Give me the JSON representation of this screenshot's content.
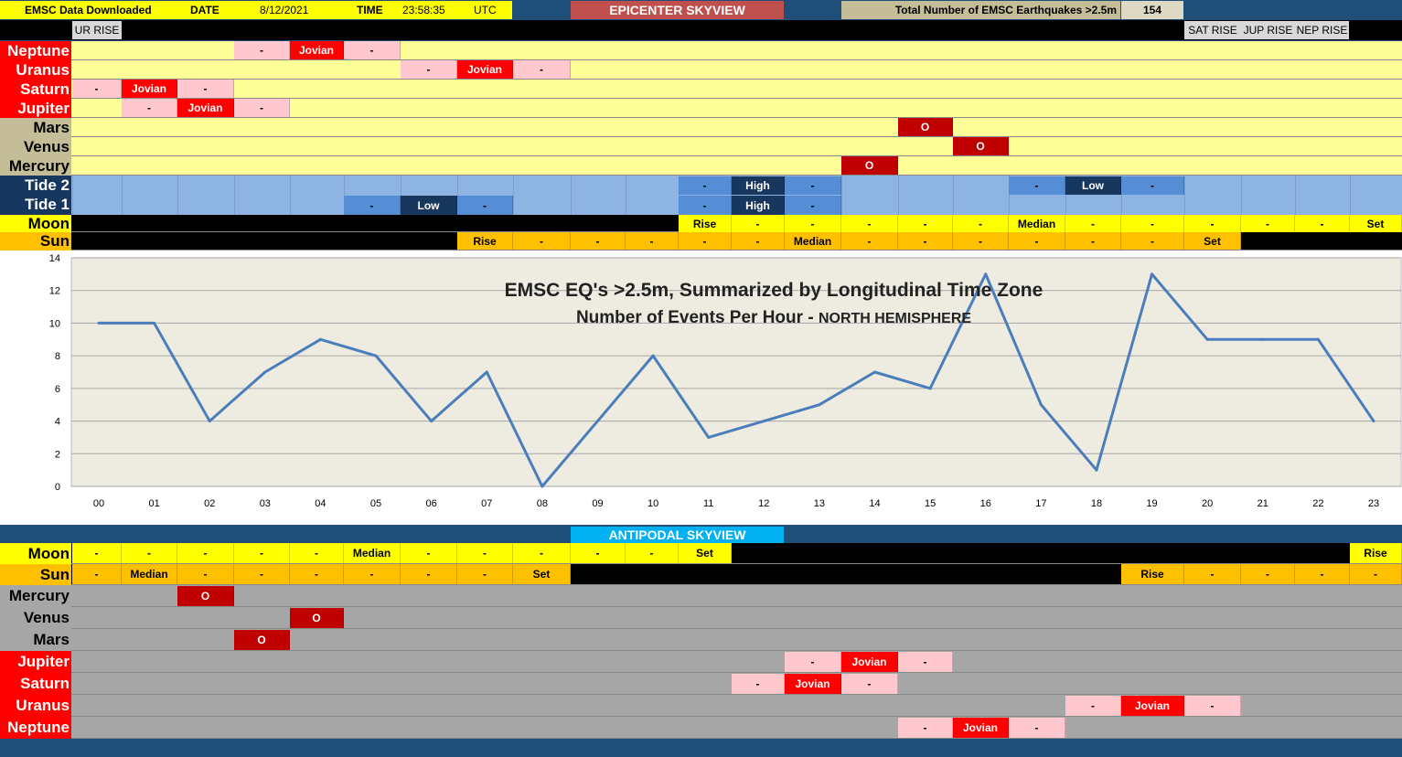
{
  "header": {
    "downloaded_label": "EMSC Data Downloaded",
    "date_label": "DATE",
    "date": "8/12/2021",
    "time_label": "TIME",
    "time": "23:58:35",
    "tz": "UTC",
    "title": "EPICENTER SKYVIEW",
    "total_label": "Total Number of EMSC Earthquakes >2.5m",
    "total": "154"
  },
  "rise_labels": {
    "ur": "UR RISE",
    "sat": "SAT RISE",
    "jup": "JUP RISE",
    "nep": "NEP RISE"
  },
  "epicenter_rows": [
    {
      "label": "Neptune",
      "cells": [
        [
          "-",
          3,
          "pink"
        ],
        [
          "Jovian",
          4,
          "red"
        ],
        [
          "-",
          5,
          "pink"
        ]
      ]
    },
    {
      "label": "Uranus",
      "cells": [
        [
          "-",
          6,
          "pink"
        ],
        [
          "Jovian",
          7,
          "red"
        ],
        [
          "-",
          8,
          "pink"
        ]
      ]
    },
    {
      "label": "Saturn",
      "cells": [
        [
          "-",
          0,
          "pink"
        ],
        [
          "Jovian",
          1,
          "red"
        ],
        [
          "-",
          2,
          "pink"
        ]
      ]
    },
    {
      "label": "Jupiter",
      "cells": [
        [
          "-",
          1,
          "pink"
        ],
        [
          "Jovian",
          2,
          "red"
        ],
        [
          "-",
          3,
          "pink"
        ]
      ]
    },
    {
      "label": "Mars",
      "cells": [
        [
          "O",
          15,
          "dred"
        ]
      ]
    },
    {
      "label": "Venus",
      "cells": [
        [
          "O",
          16,
          "dred"
        ]
      ]
    },
    {
      "label": "Mercury",
      "cells": [
        [
          "O",
          14,
          "dred"
        ]
      ]
    }
  ],
  "tides": {
    "tide2_label": "Tide 2",
    "tide1_label": "Tide 1",
    "tide2_cells": [
      [
        "-",
        11
      ],
      [
        "High",
        12
      ],
      [
        "-",
        13
      ],
      [
        "-",
        17
      ],
      [
        "Low",
        18
      ],
      [
        "-",
        19
      ]
    ],
    "tide1_cells": [
      [
        "-",
        5
      ],
      [
        "Low",
        6
      ],
      [
        "-",
        7
      ],
      [
        "-",
        11
      ],
      [
        "High",
        12
      ],
      [
        "-",
        13
      ]
    ]
  },
  "epi_moon": {
    "label": "Moon",
    "cells": [
      [
        "Rise",
        11
      ],
      [
        "-",
        12
      ],
      [
        "-",
        13
      ],
      [
        "-",
        14
      ],
      [
        "-",
        15
      ],
      [
        "-",
        16
      ],
      [
        "Median",
        17
      ],
      [
        "-",
        18
      ],
      [
        "-",
        19
      ],
      [
        "-",
        20
      ],
      [
        "-",
        21
      ],
      [
        "-",
        22
      ],
      [
        "Set",
        23
      ]
    ]
  },
  "epi_sun": {
    "label": "Sun",
    "cells": [
      [
        "Rise",
        7
      ],
      [
        "-",
        8
      ],
      [
        "-",
        9
      ],
      [
        "-",
        10
      ],
      [
        "-",
        11
      ],
      [
        "-",
        12
      ],
      [
        "Median",
        13
      ],
      [
        "-",
        14
      ],
      [
        "-",
        15
      ],
      [
        "-",
        16
      ],
      [
        "-",
        17
      ],
      [
        "-",
        18
      ],
      [
        "-",
        19
      ],
      [
        "Set",
        20
      ]
    ]
  },
  "chart_data": {
    "type": "line",
    "title": "EMSC EQ's >2.5m, Summarized by Longitudinal Time Zone",
    "subtitle_main": "Number of Events Per Hour - ",
    "subtitle_tail": "NORTH  HEMISPHERE",
    "categories": [
      "00",
      "01",
      "02",
      "03",
      "04",
      "05",
      "06",
      "07",
      "08",
      "09",
      "10",
      "11",
      "12",
      "13",
      "14",
      "15",
      "16",
      "17",
      "18",
      "19",
      "20",
      "21",
      "22",
      "23"
    ],
    "values": [
      10,
      10,
      4,
      7,
      9,
      8,
      4,
      7,
      0,
      4,
      8,
      3,
      4,
      5,
      7,
      6,
      13,
      5,
      1,
      13,
      9,
      9,
      9,
      4
    ],
    "yticks": [
      "0",
      "2",
      "4",
      "6",
      "8",
      "10",
      "12",
      "14"
    ],
    "ylim": [
      0,
      14
    ],
    "grid": true,
    "line_color": "#4a7ebb"
  },
  "antipodal": {
    "title": "ANTIPODAL SKYVIEW",
    "moon": {
      "label": "Moon",
      "cells": [
        [
          "-",
          0
        ],
        [
          "-",
          1
        ],
        [
          "-",
          2
        ],
        [
          "-",
          3
        ],
        [
          "-",
          4
        ],
        [
          "Median",
          5
        ],
        [
          "-",
          6
        ],
        [
          "-",
          7
        ],
        [
          "-",
          8
        ],
        [
          "-",
          9
        ],
        [
          "-",
          10
        ],
        [
          "Set",
          11
        ],
        [
          "Rise",
          23
        ]
      ]
    },
    "sun": {
      "label": "Sun",
      "cells": [
        [
          "-",
          0
        ],
        [
          "Median",
          1
        ],
        [
          "-",
          2
        ],
        [
          "-",
          3
        ],
        [
          "-",
          4
        ],
        [
          "-",
          5
        ],
        [
          "-",
          6
        ],
        [
          "-",
          7
        ],
        [
          "Set",
          8
        ],
        [
          "Rise",
          19
        ],
        [
          "-",
          20
        ],
        [
          "-",
          21
        ],
        [
          "-",
          22
        ],
        [
          "-",
          23
        ]
      ]
    },
    "rows": [
      {
        "label": "Mercury",
        "cells": [
          [
            "O",
            2,
            "dred"
          ]
        ]
      },
      {
        "label": "Venus",
        "cells": [
          [
            "O",
            4,
            "dred"
          ]
        ]
      },
      {
        "label": "Mars",
        "cells": [
          [
            "O",
            3,
            "dred"
          ]
        ]
      },
      {
        "label": "Jupiter",
        "cells": [
          [
            "-",
            13,
            "pink"
          ],
          [
            "Jovian",
            14,
            "red"
          ],
          [
            "-",
            15,
            "pink"
          ]
        ]
      },
      {
        "label": "Saturn",
        "cells": [
          [
            "-",
            12,
            "pink"
          ],
          [
            "Jovian",
            13,
            "red"
          ],
          [
            "-",
            14,
            "pink"
          ]
        ]
      },
      {
        "label": "Uranus",
        "cells": [
          [
            "-",
            18,
            "pink"
          ],
          [
            "Jovian",
            19,
            "red"
          ],
          [
            "-",
            20,
            "pink"
          ]
        ]
      },
      {
        "label": "Neptune",
        "cells": [
          [
            "-",
            15,
            "pink"
          ],
          [
            "Jovian",
            16,
            "red"
          ],
          [
            "-",
            17,
            "pink"
          ]
        ]
      }
    ]
  },
  "colors": {
    "yellow_row": "#ffff99",
    "pink": "#ffc7ce",
    "red": "#ff0000",
    "dark_red": "#c00000",
    "tide_light": "#8eb4e3",
    "tide_mid": "#558ed5",
    "tide_dark": "#17375e",
    "moon_yellow": "#ffff00",
    "sun_orange": "#ffc000",
    "gray_row": "#a6a6a6",
    "navy": "#1f4e79",
    "tan": "#c4bd97",
    "title_red": "#c0504d",
    "cyan": "#00b0f0"
  }
}
